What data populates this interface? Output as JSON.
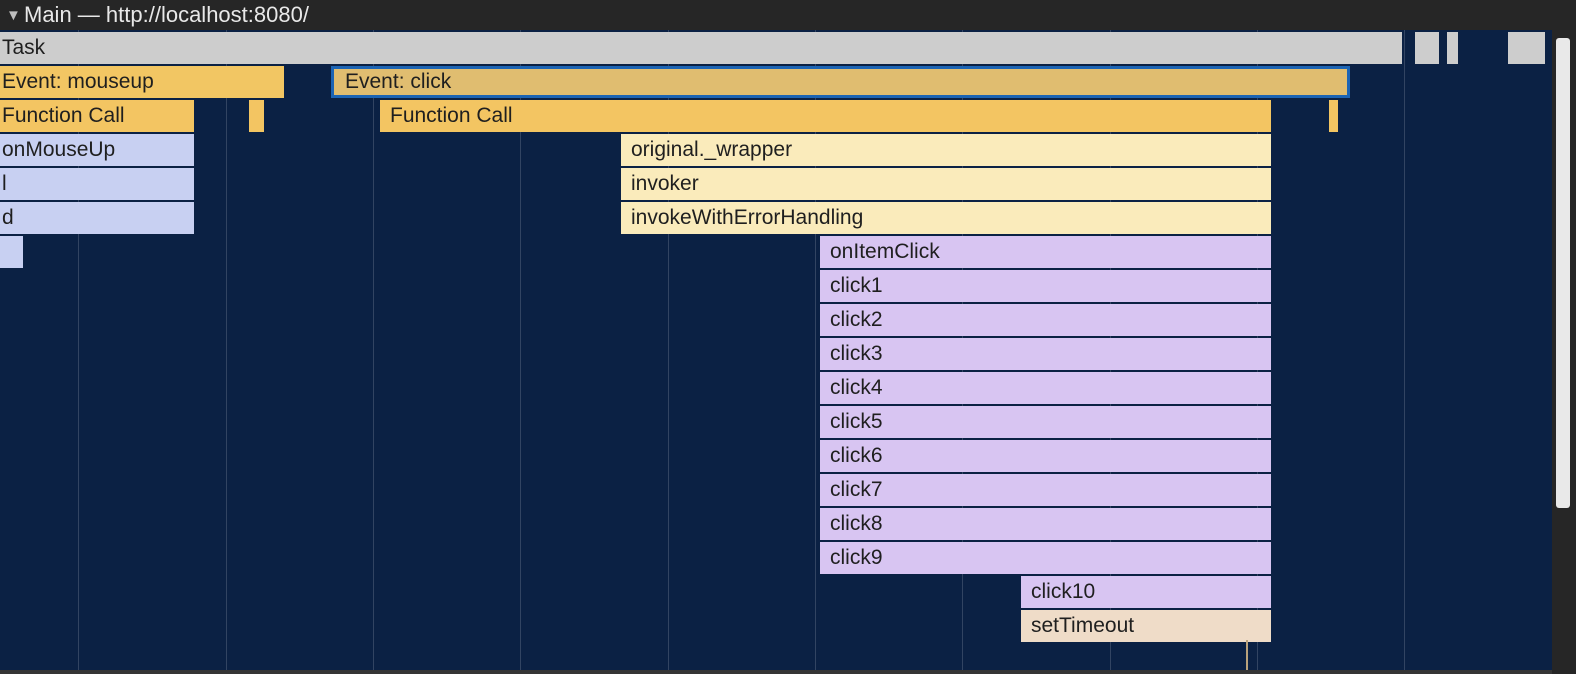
{
  "header": {
    "expand_icon": "triangle-down-icon",
    "title": "Main — http://localhost:8080/"
  },
  "colors": {
    "background": "#0b2144",
    "task": "#cdcdcd",
    "event": "#f2c663",
    "selected_outline": "#1c64b4",
    "function_call": "#f3c562",
    "js_user": "#c8d0f2",
    "wrapper": "#faebbb",
    "app_functions": "#d8c5f2",
    "timer": "#efdcc8"
  },
  "flame": {
    "task": "Task",
    "event_mouseup": "Event: mouseup",
    "event_click": "Event: click",
    "function_call": "Function Call",
    "function_call_2": "Function Call",
    "on_mouse_up": "onMouseUp",
    "l": "l",
    "d": "d",
    "original_wrapper": "original._wrapper",
    "invoker": "invoker",
    "invoke_with_error_handling": "invokeWithErrorHandling",
    "on_item_click": "onItemClick",
    "click1": "click1",
    "click2": "click2",
    "click3": "click3",
    "click4": "click4",
    "click5": "click5",
    "click6": "click6",
    "click7": "click7",
    "click8": "click8",
    "click9": "click9",
    "click10": "click10",
    "set_timeout": "setTimeout"
  }
}
